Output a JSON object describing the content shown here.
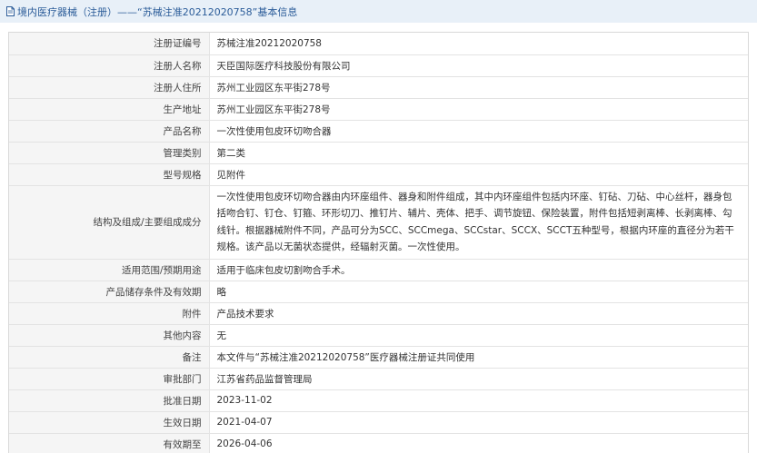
{
  "header": {
    "title": "境内医疗器械（注册）——“苏械注准20212020758”基本信息"
  },
  "rows": [
    {
      "label": "注册证编号",
      "value": "苏械注准20212020758"
    },
    {
      "label": "注册人名称",
      "value": "天臣国际医疗科技股份有限公司"
    },
    {
      "label": "注册人住所",
      "value": "苏州工业园区东平街278号"
    },
    {
      "label": "生产地址",
      "value": "苏州工业园区东平街278号"
    },
    {
      "label": "产品名称",
      "value": "一次性使用包皮环切吻合器"
    },
    {
      "label": "管理类别",
      "value": "第二类"
    },
    {
      "label": "型号规格",
      "value": "见附件"
    },
    {
      "label": "结构及组成/主要组成成分",
      "value": "一次性使用包皮环切吻合器由内环座组件、器身和附件组成，其中内环座组件包括内环座、钉砧、刀砧、中心丝杆，器身包括吻合钉、钉仓、钉箍、环形切刀、推钉片、辅片、壳体、把手、调节旋钮、保险装置，附件包括短剥离棒、长剥离棒、勾线针。根据器械附件不同，产品可分为SCC、SCCmega、SCCstar、SCCX、SCCT五种型号，根据内环座的直径分为若干规格。该产品以无菌状态提供，经辐射灭菌。一次性使用。"
    },
    {
      "label": "适用范围/预期用途",
      "value": "适用于临床包皮切割吻合手术。"
    },
    {
      "label": "产品储存条件及有效期",
      "value": "略"
    },
    {
      "label": "附件",
      "value": "产品技术要求"
    },
    {
      "label": "其他内容",
      "value": "无"
    },
    {
      "label": "备注",
      "value": "本文件与“苏械注准20212020758”医疗器械注册证共同使用"
    },
    {
      "label": "审批部门",
      "value": "江苏省药品监督管理局"
    },
    {
      "label": "批准日期",
      "value": "2023-11-02"
    },
    {
      "label": "生效日期",
      "value": "2021-04-07"
    },
    {
      "label": "有效期至",
      "value": "2026-04-06"
    }
  ]
}
